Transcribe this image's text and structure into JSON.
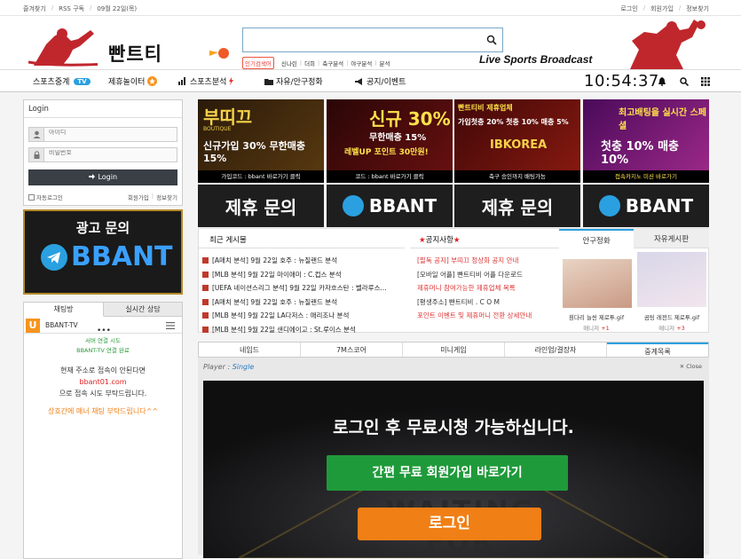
{
  "topbar": {
    "bookmark": "즐겨찾기",
    "rss": "RSS 구독",
    "date": "09월 22일(목)",
    "login": "로그인",
    "signup": "회원가입",
    "find_info": "정보찾기"
  },
  "header": {
    "logo_text": "빤트티비",
    "search_placeholder": "",
    "popular_label": "인기검색어",
    "popular_terms": [
      "신나린",
      "더희",
      "축구분석",
      "야구분석",
      "분석"
    ],
    "live_text": "Live Sports Broadcast"
  },
  "nav": {
    "items": [
      "스포츠중계",
      "제휴놀이터",
      "스포츠분석",
      "자유/안구정화",
      "공지/이벤트"
    ],
    "tv_badge": "TV",
    "clock": "10:54:37"
  },
  "login_box": {
    "title": "Login",
    "id_placeholder": "아이디",
    "pw_placeholder": "비밀번호",
    "button": "Login",
    "auto_login": "자동로그인",
    "signup": "회원가입",
    "find": "정보찾기"
  },
  "left_ad": {
    "line1": "광고 문의",
    "line2": "BBANT"
  },
  "chat": {
    "tab1": "채팅방",
    "tab2": "실시간 상담",
    "room_name": "BBANT-TV",
    "logo_letter": "U",
    "sys1": "서버 연결 시도",
    "sys2": "BBANT-TV 연결 완료",
    "msg1": "현재 주소로 접속이 안된다면",
    "domain": "bbant01.com",
    "msg2": "으로 접속 시도 부탁드립니다.",
    "msg3": "상호간에 매너 채팅 부탁드립니다^^"
  },
  "banners": [
    {
      "title": "부띠끄",
      "sub": "신규가입 30% 무한매충 15%",
      "code": "가입코드 : bbant 바로가기 클릭",
      "tag": "BOUTIQUE"
    },
    {
      "title": "신규 30%",
      "sub": "무한매충 15%",
      "code": "코드 : bbant 바로가기 클릭",
      "tag": "레벨UP 포인트 30만원!"
    },
    {
      "title": "빤트티비 제휴업체",
      "sub": "IBKOREA",
      "code": "축구 승인까지 배팅가능",
      "tag": "가입첫충 20% 첫충 10% 매충 5%"
    },
    {
      "title": "최고배팅을 실시간 스페셜",
      "sub": "첫충 10% 매충 10%",
      "code": "접속카지노 미션 바로가기",
      "tag": ""
    }
  ],
  "cta": [
    "제휴 문의",
    "BBANT",
    "제휴 문의",
    "BBANT"
  ],
  "boards": {
    "recent_title": "최근 게시물",
    "recent": [
      "[A매치 분석] 9월 22일 호주 : 뉴질랜드 분석",
      "[MLB 분석] 9월 22일 마이애미 : C.컵스 분석",
      "[UEFA 네이션스리그 분석] 9월 22일 카자흐스탄 : 벨라루스...",
      "[A매치 분석] 9월 22일 호주 : 뉴질랜드 분석",
      "[MLB 분석] 9월 22일 LA다저스 : 애리조나 분석",
      "[MLB 분석] 9월 22일 샌디에이고 : St.루이스 분석"
    ],
    "notice_title": "공지사항",
    "notices": [
      "[필독 공지] 부띠끄 정상화 공지 안내",
      "[모바일 어플] 빤트티비 어플 다운로드",
      "제휴머니 참여가능한 제휴업체 목록",
      "[평생주소] 빤트티비 . C O M",
      "포인트 이벤트 및 제휴머니 전환 상세안내"
    ],
    "photo_tabs": [
      "안구정화",
      "자유게시판"
    ],
    "photos": [
      {
        "caption": "흰다리 늘씬 제로투.gif",
        "author": "매니저",
        "count": "+1"
      },
      {
        "caption": "곰팅 레전드 제로투.gif",
        "author": "매니저",
        "count": "+3"
      }
    ]
  },
  "lower_tabs": [
    "네임드",
    "7M스코어",
    "미니게임",
    "라인업/결장자",
    "중계목록"
  ],
  "player": {
    "label": "Player :",
    "mode": "Single",
    "close": "Close",
    "message": "로그인 후 무료시청 가능하십니다.",
    "join_btn": "간편 무료 회원가입 바로가기",
    "login_btn": "로그인",
    "bg_text": "WAITING FOR"
  },
  "colors": {
    "accent_blue": "#2aa0e0",
    "red": "#c0392b",
    "green_btn": "#1f9a3a",
    "orange_btn": "#f07f15"
  }
}
